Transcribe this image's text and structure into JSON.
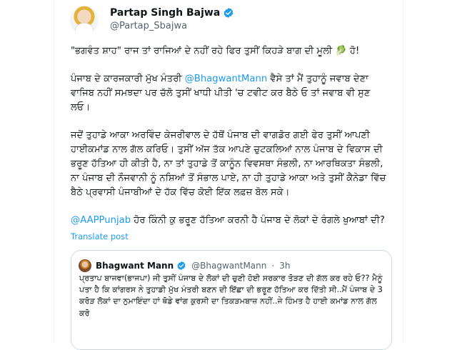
{
  "author": {
    "name": "Partap Singh Bajwa",
    "handle": "@Partap_Sbajwa"
  },
  "tweet": {
    "p1": "\"ਭਗਵੰਤ ਸ਼ਾਹ\" ਰਾਜ ਤਾਂ ਰਾਜਿਆਂ ਦੇ ਨਹੀਂ ਰਹੇ ਫਿਰ ਤੁਸੀਂ ਕਿਹੜੇ ਬਾਗ ਦੀ ਮੂਲੀ 🥬 ਹੋ!",
    "p2_before": "ਪੰਜਾਬ ਦੇ ਕਾਰਜਕਾਰੀ ਮੁੱਖ ਮੰਤਰੀ ",
    "p2_mention": "@BhagwantMann",
    "p2_after": " ਵੈਸੇ ਤਾਂ ਮੈਂ ਤੁਹਾਨੂੰ ਜਵਾਬ ਦੇਣਾ ਵਾਜਿਬ ਨਹੀਂ ਸਮਝਦਾ ਪਰ ਚੱਲੋ ਤੁਸੀਂ ਖਾਧੀ ਪੀਤੀ 'ਚ ਟਵੀਟ ਕਰ ਬੈਠੇ ਓ ਤਾਂ ਜਵਾਬ ਵੀ ਸੁਣ ਲਓ।",
    "p3": "ਜਦੋਂ ਤੁਹਾਡੇ ਆਕਾ ਅਰਵਿੰਦ ਕੇਜਰੀਵਾਲ ਦੇ ਹੱਥੋਂ ਪੰਜਾਬ ਦੀ ਵਾਗਡੋਰ ਗਈ ਫੇਰ ਤੁਸੀਂ ਆਪਣੀ ਹਾਈਕਮਾਂਡ ਨਾਲ ਗੱਲ ਕਰਿਓ। ਤੁਸੀਂ ਅੱਜ ਤੱਕ ਆਪਣੇ ਚੁਟਕਲਿਆਂ ਨਾਲ ਪੰਜਾਬ ਦੇ ਵਿਕਾਸ ਦੀ ਭਰੂਣ ਹੱਤਿਆ ਹੀ ਕੀਤੀ ਹੈ, ਨਾ ਤਾਂ ਤੁਹਾਡੇ ਤੋਂ ਕਾਨੂੰਨ ਵਿਵਸਥਾ ਸੰਭਲੀ, ਨਾ ਆਰਥਿਕਤਾ ਸੰਭਲੀ, ਨਾ ਪੰਜਾਬ ਦੀ ਨੌਜਵਾਨੀ ਨੂੰ ਨਸ਼ਿਆਂ ਤੋਂ ਸੰਭਾਲ ਪਾਏ, ਨਾ ਹੀ ਤੁਹਾਡੇ ਆਕਾ ਅਤੇ ਤੁਸੀਂ ਕੈਨੇਡਾ ਵਿੱਚ ਬੈਠੇ ਪ੍ਰਵਾਸੀ ਪੰਜਾਬੀਆਂ ਦੇ ਹੱਕ ਵਿੱਚ ਕੋਈ ਇੱਕ ਲਫ਼ਜ਼ ਬੋਲ ਸਕੇ।",
    "p4_mention": "@AAPPunjab",
    "p4_after": " ਹੋਰ ਕਿੰਨੀ ਕੁ ਭਰੂਣ ਹੱਤਿਆ ਕਰਨੀ ਹੈ ਪੰਜਾਬ ਦੇ ਲੋਕਾਂ ਦੇ ਰੰਗਲੇ ਖੁਆਬਾਂ ਦੀ?",
    "translate": "Translate post"
  },
  "quote": {
    "name": "Bhagwant Mann",
    "handle": "@BhagwantMann",
    "dot": "·",
    "time": "3h",
    "text": "ਪ੍ਰਤਾਪ ਬਾਜਵਾ(ਭਾਜਪਾ) ਜੀ ਤੁਸੀਂ ਪੰਜਾਬ ਦੇ ਲੋਕਾਂ ਦੀ ਚੁਣੀ ਹੋਈ ਸਰਕਾਰ ਤੋੜਣ ਦੀ ਗੱਲ ਕਰ ਰਹੇ ਓ?? ਮੈਨੂੰ ਪਤਾ ਹੈ ਕਿ ਕਾਂਗਰਸ ਨੇ ਤੁਹਾਡੀ ਮੁੱਖ ਮੰਤਰੀ ਬਣਨ ਦੀ ਇੱਛਾ ਦੀ ਭਰੂਣ ਹੱਤਿਆ ਕਰ ਦਿੱਤੀ ਸੀ..ਮੈਂ ਪੰਜਾਬ ਦੇ 3 ਕਰੋੜ ਲੋਕਾਂ ਦਾ ਨੁਮਾਇੰਦਾ ਹਾਂ ਥੋਡੇ ਵਾਂਗ ਕੁਰਸੀ ਦਾ ਤਿਕੜਮਬਾਜ਼ ਨਹੀਂ..ਜੇ ਹਿੰਮਤ ਹੈ ਹਾਈ ਕਮਾਂਡ ਨਾਲ ਗੱਲ ਕਰੋ"
  },
  "colors": {
    "accent": "#1d9bf0",
    "text": "#0f1419",
    "muted": "#536471",
    "border": "#cfd9de"
  }
}
